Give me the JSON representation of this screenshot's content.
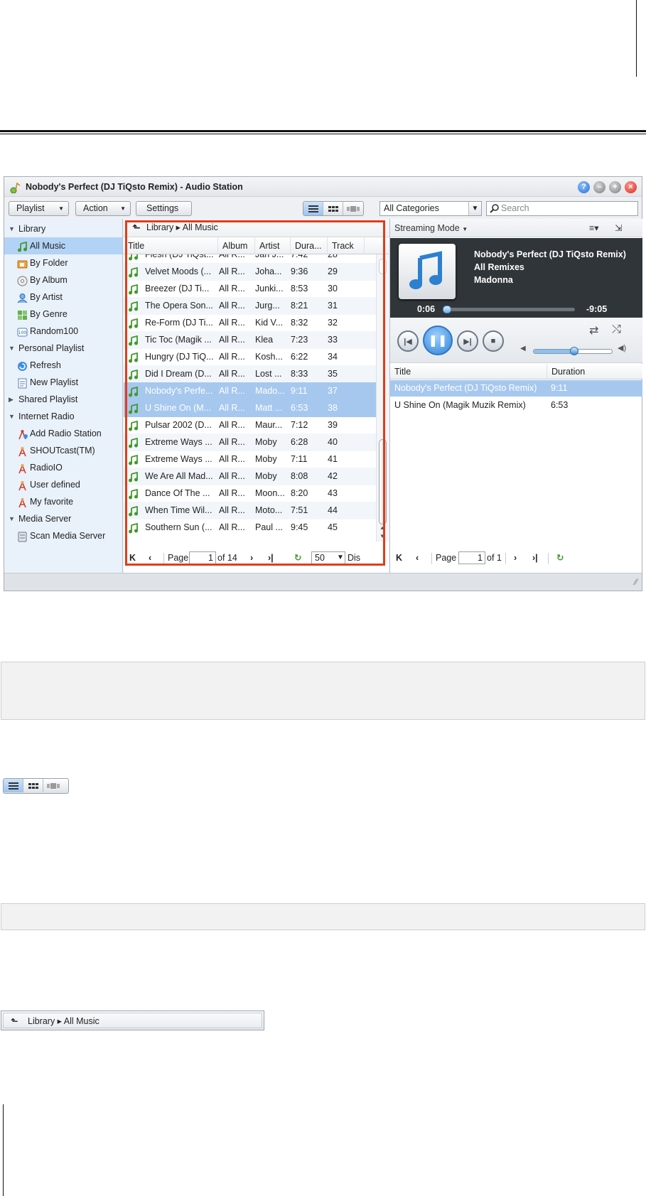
{
  "window": {
    "title": "Nobody's Perfect (DJ TiQsto Remix) - Audio Station",
    "buttons": {
      "help": "?",
      "close": "×"
    }
  },
  "toolbar": {
    "playlist_label": "Playlist",
    "action_label": "Action",
    "settings_label": "Settings",
    "category_value": "All Categories",
    "search_placeholder": "Search"
  },
  "sidebar": {
    "items": [
      {
        "label": "Library",
        "level": 0,
        "expanded": true,
        "icon": "none",
        "selected": false
      },
      {
        "label": "All Music",
        "level": 1,
        "icon": "music-note-icon",
        "selected": true
      },
      {
        "label": "By Folder",
        "level": 1,
        "icon": "folder-icon",
        "selected": false
      },
      {
        "label": "By Album",
        "level": 1,
        "icon": "cd-icon",
        "selected": false
      },
      {
        "label": "By Artist",
        "level": 1,
        "icon": "person-icon",
        "selected": false
      },
      {
        "label": "By Genre",
        "level": 1,
        "icon": "genre-icon",
        "selected": false
      },
      {
        "label": "Random100",
        "level": 1,
        "icon": "random100-icon",
        "selected": false
      },
      {
        "label": "Personal Playlist",
        "level": 0,
        "expanded": true,
        "icon": "none",
        "selected": false
      },
      {
        "label": "Refresh",
        "level": 1,
        "icon": "refresh-icon",
        "selected": false
      },
      {
        "label": "New Playlist",
        "level": 1,
        "icon": "new-playlist-icon",
        "selected": false
      },
      {
        "label": "Shared Playlist",
        "level": 0,
        "expanded": false,
        "icon": "none",
        "selected": false
      },
      {
        "label": "Internet Radio",
        "level": 0,
        "expanded": true,
        "icon": "none",
        "selected": false
      },
      {
        "label": "Add Radio Station",
        "level": 1,
        "icon": "add-radio-icon",
        "selected": false
      },
      {
        "label": "SHOUTcast(TM)",
        "level": 1,
        "icon": "radio-tower-icon",
        "selected": false
      },
      {
        "label": "RadioIO",
        "level": 1,
        "icon": "radio-tower-icon",
        "selected": false
      },
      {
        "label": "User defined",
        "level": 1,
        "icon": "radio-tower-icon",
        "selected": false
      },
      {
        "label": "My favorite",
        "level": 1,
        "icon": "radio-tower-icon",
        "selected": false
      },
      {
        "label": "Media Server",
        "level": 0,
        "expanded": true,
        "icon": "none",
        "selected": false
      },
      {
        "label": "Scan Media Server",
        "level": 1,
        "icon": "media-server-icon",
        "selected": false
      }
    ]
  },
  "list": {
    "breadcrumb": "Library ▸ All Music",
    "columns": [
      "Title",
      "Album",
      "Artist",
      "Dura...",
      "Track"
    ],
    "rows": [
      {
        "title": "Flesh (DJ TiQst...",
        "album": "All R...",
        "artist": "Jan J...",
        "duration": "7:42",
        "track": "28",
        "selected": false
      },
      {
        "title": "Velvet Moods (...",
        "album": "All R...",
        "artist": "Joha...",
        "duration": "9:36",
        "track": "29",
        "selected": false
      },
      {
        "title": "Breezer (DJ Ti...",
        "album": "All R...",
        "artist": "Junki...",
        "duration": "8:53",
        "track": "30",
        "selected": false
      },
      {
        "title": "The Opera Son...",
        "album": "All R...",
        "artist": "Jurg...",
        "duration": "8:21",
        "track": "31",
        "selected": false
      },
      {
        "title": "Re-Form (DJ Ti...",
        "album": "All R...",
        "artist": "Kid V...",
        "duration": "8:32",
        "track": "32",
        "selected": false
      },
      {
        "title": "Tic Toc (Magik ...",
        "album": "All R...",
        "artist": "Klea",
        "duration": "7:23",
        "track": "33",
        "selected": false
      },
      {
        "title": "Hungry (DJ TiQ...",
        "album": "All R...",
        "artist": "Kosh...",
        "duration": "6:22",
        "track": "34",
        "selected": false
      },
      {
        "title": "Did I Dream (D...",
        "album": "All R...",
        "artist": "Lost ...",
        "duration": "8:33",
        "track": "35",
        "selected": false
      },
      {
        "title": "Nobody's Perfe...",
        "album": "All R...",
        "artist": "Mado...",
        "duration": "9:11",
        "track": "37",
        "selected": true
      },
      {
        "title": "U Shine On (M...",
        "album": "All R...",
        "artist": "Matt ...",
        "duration": "6:53",
        "track": "38",
        "selected": true
      },
      {
        "title": "Pulsar 2002 (D...",
        "album": "All R...",
        "artist": "Maur...",
        "duration": "7:12",
        "track": "39",
        "selected": false
      },
      {
        "title": "Extreme Ways ...",
        "album": "All R...",
        "artist": "Moby",
        "duration": "6:28",
        "track": "40",
        "selected": false
      },
      {
        "title": "Extreme Ways ...",
        "album": "All R...",
        "artist": "Moby",
        "duration": "7:11",
        "track": "41",
        "selected": false
      },
      {
        "title": "We Are All Mad...",
        "album": "All R...",
        "artist": "Moby",
        "duration": "8:08",
        "track": "42",
        "selected": false
      },
      {
        "title": "Dance Of The ...",
        "album": "All R...",
        "artist": "Moon...",
        "duration": "8:20",
        "track": "43",
        "selected": false
      },
      {
        "title": "When Time Wil...",
        "album": "All R...",
        "artist": "Moto...",
        "duration": "7:51",
        "track": "44",
        "selected": false
      },
      {
        "title": "Southern Sun (...",
        "album": "All R...",
        "artist": "Paul ...",
        "duration": "9:45",
        "track": "45",
        "selected": false
      }
    ],
    "pager": {
      "page_label": "Page",
      "page_value": "1",
      "of_label": "of 14",
      "page_size": "50",
      "display_label": "Dis"
    }
  },
  "player": {
    "mode_label": "Streaming Mode",
    "title": "Nobody's Perfect (DJ TiQsto Remix)",
    "album": "All Remixes",
    "artist": "Madonna",
    "elapsed": "0:06",
    "remaining": "-9:05",
    "progress_fraction": 0.011,
    "volume_fraction": 0.52,
    "playlist_columns": [
      "Title",
      "Duration"
    ],
    "playlist": [
      {
        "title": "Nobody's Perfect (DJ TiQsto Remix)",
        "duration": "9:11",
        "selected": true
      },
      {
        "title": "U Shine On (Magik Muzik Remix)",
        "duration": "6:53",
        "selected": false
      }
    ],
    "pager": {
      "page_label": "Page",
      "page_value": "1",
      "of_label": "of 1"
    }
  },
  "callout": {
    "breadcrumb": "Library ▸ All Music"
  },
  "colors": {
    "selection": "#a6c8ee",
    "highlight": "#e53a1a",
    "accent": "#2f83d6",
    "sidebar_bg": "#e9f1fa"
  }
}
